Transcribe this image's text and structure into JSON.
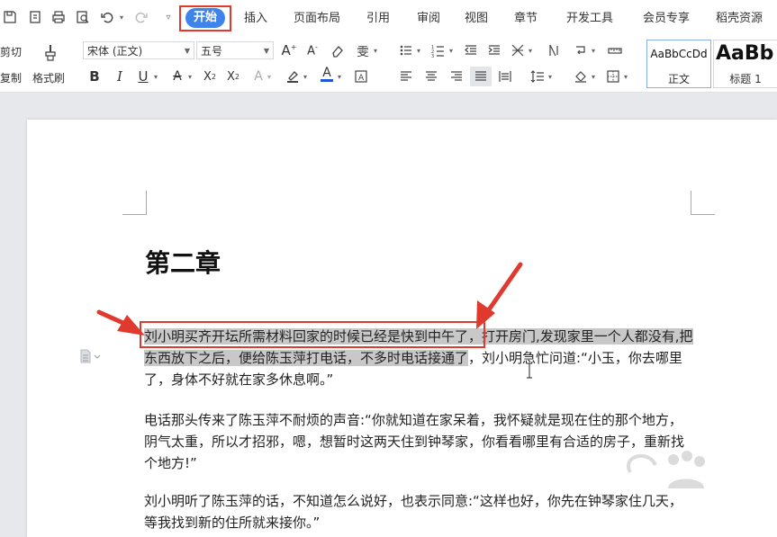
{
  "menu": {
    "tabs": [
      {
        "label": "开始",
        "active": true
      },
      {
        "label": "插入"
      },
      {
        "label": "页面布局"
      },
      {
        "label": "引用"
      },
      {
        "label": "审阅"
      },
      {
        "label": "视图"
      },
      {
        "label": "章节"
      },
      {
        "label": "开发工具"
      },
      {
        "label": "会员专享"
      },
      {
        "label": "稻壳资源"
      }
    ]
  },
  "ribbon": {
    "cut_label": "剪切",
    "copy_label": "复制",
    "format_painter_label": "格式刷",
    "font_name": "宋体 (正文)",
    "font_size": "五号",
    "styles": [
      {
        "sample": "AaBbCcDd",
        "name": "正文"
      },
      {
        "sample": "AaBb",
        "name": "标题 1"
      }
    ]
  },
  "document": {
    "chapter_title": "第二章",
    "p1_hl": "刘小明买齐开坛所需材料回家的时候已经是快到中午了，打开房门,发现家里一个人都没有,把东西放下之后，便给陈玉萍打电话，不多时电话接通了",
    "p1_rest": "，刘小明急忙问道:“小玉，你去哪里了，身体不好就在家多休息啊。”",
    "p2": "电话那头传来了陈玉萍不耐烦的声音:“你就知道在家呆着，我怀疑就是现在住的那个地方，阴气太重，所以才招邪，嗯，想暂时这两天住到钟琴家，你看看哪里有合适的房子，重新找个地方!”",
    "p3": "刘小明听了陈玉萍的话，不知道怎么说好，也表示同意:“这样也好，你先在钟琴家住几天，等我找到新的住所就来接你。”"
  },
  "colors": {
    "active_tab": "#3f84ea",
    "annotation_red": "#e03a2f",
    "selection": "#c8c8c8"
  }
}
